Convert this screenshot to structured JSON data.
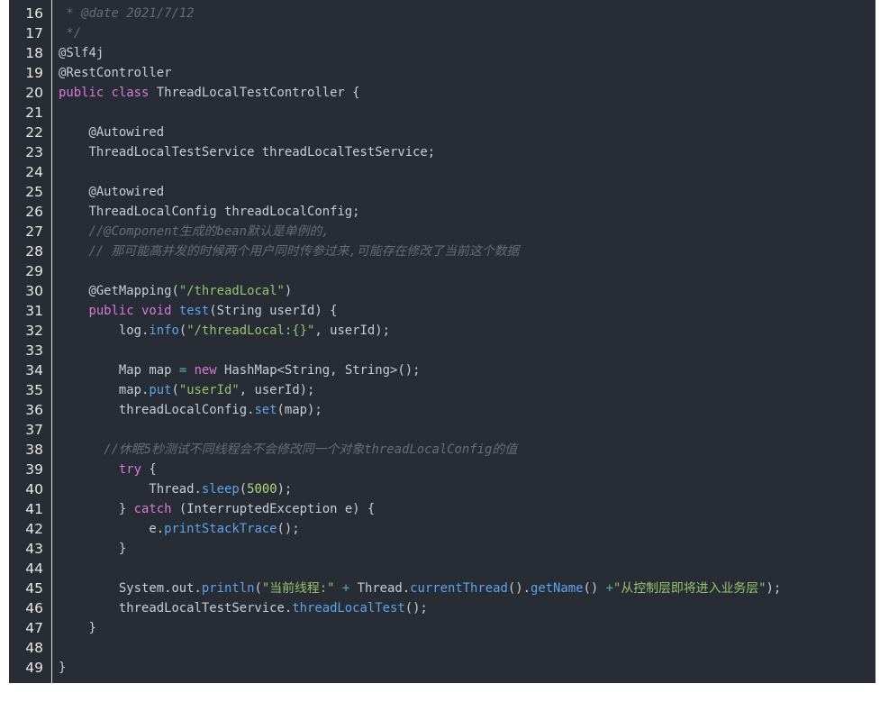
{
  "editor": {
    "lines": [
      {
        "n": "16",
        "tokens": [
          {
            "t": " * @date 2021/7/12",
            "c": "comment"
          }
        ]
      },
      {
        "n": "17",
        "tokens": [
          {
            "t": " */",
            "c": "comment"
          }
        ]
      },
      {
        "n": "18",
        "tokens": [
          {
            "t": "@Slf4j",
            "c": "plain"
          }
        ]
      },
      {
        "n": "19",
        "tokens": [
          {
            "t": "@RestController",
            "c": "plain"
          }
        ]
      },
      {
        "n": "20",
        "tokens": [
          {
            "t": "public class",
            "c": "keyword"
          },
          {
            "t": " ThreadLocalTestController {",
            "c": "plain"
          }
        ]
      },
      {
        "n": "21",
        "tokens": []
      },
      {
        "n": "22",
        "tokens": [
          {
            "t": "    @Autowired",
            "c": "plain"
          }
        ]
      },
      {
        "n": "23",
        "tokens": [
          {
            "t": "    ThreadLocalTestService threadLocalTestService;",
            "c": "plain"
          }
        ]
      },
      {
        "n": "24",
        "tokens": []
      },
      {
        "n": "25",
        "tokens": [
          {
            "t": "    @Autowired",
            "c": "plain"
          }
        ]
      },
      {
        "n": "26",
        "tokens": [
          {
            "t": "    ThreadLocalConfig threadLocalConfig;",
            "c": "plain"
          }
        ]
      },
      {
        "n": "27",
        "tokens": [
          {
            "t": "    //@Component生成的bean默认是单例的,",
            "c": "comment"
          }
        ]
      },
      {
        "n": "28",
        "tokens": [
          {
            "t": "    // 那可能高并发的时候两个用户同时传参过来,可能存在修改了当前这个数据",
            "c": "comment"
          }
        ]
      },
      {
        "n": "29",
        "tokens": []
      },
      {
        "n": "30",
        "tokens": [
          {
            "t": "    @GetMapping(",
            "c": "plain"
          },
          {
            "t": "\"/threadLocal\"",
            "c": "string"
          },
          {
            "t": ")",
            "c": "plain"
          }
        ]
      },
      {
        "n": "31",
        "tokens": [
          {
            "t": "    ",
            "c": "plain"
          },
          {
            "t": "public void",
            "c": "keyword"
          },
          {
            "t": " ",
            "c": "plain"
          },
          {
            "t": "test",
            "c": "func"
          },
          {
            "t": "(String userId) {",
            "c": "plain"
          }
        ]
      },
      {
        "n": "32",
        "tokens": [
          {
            "t": "        log.",
            "c": "plain"
          },
          {
            "t": "info",
            "c": "func"
          },
          {
            "t": "(",
            "c": "plain"
          },
          {
            "t": "\"/threadLocal:{}\"",
            "c": "string"
          },
          {
            "t": ", userId);",
            "c": "plain"
          }
        ]
      },
      {
        "n": "33",
        "tokens": []
      },
      {
        "n": "34",
        "tokens": [
          {
            "t": "        Map map ",
            "c": "plain"
          },
          {
            "t": "=",
            "c": "operator"
          },
          {
            "t": " ",
            "c": "plain"
          },
          {
            "t": "new",
            "c": "keyword"
          },
          {
            "t": " HashMap<String, String>();",
            "c": "plain"
          }
        ]
      },
      {
        "n": "35",
        "tokens": [
          {
            "t": "        map.",
            "c": "plain"
          },
          {
            "t": "put",
            "c": "func"
          },
          {
            "t": "(",
            "c": "plain"
          },
          {
            "t": "\"userId\"",
            "c": "string"
          },
          {
            "t": ", userId);",
            "c": "plain"
          }
        ]
      },
      {
        "n": "36",
        "tokens": [
          {
            "t": "        threadLocalConfig.",
            "c": "plain"
          },
          {
            "t": "set",
            "c": "func"
          },
          {
            "t": "(map);",
            "c": "plain"
          }
        ]
      },
      {
        "n": "37",
        "tokens": []
      },
      {
        "n": "38",
        "tokens": [
          {
            "t": "      //休眠5秒测试不同线程会不会修改同一个对象threadLocalConfig的值",
            "c": "comment"
          }
        ]
      },
      {
        "n": "39",
        "tokens": [
          {
            "t": "        ",
            "c": "plain"
          },
          {
            "t": "try",
            "c": "keyword"
          },
          {
            "t": " {",
            "c": "plain"
          }
        ]
      },
      {
        "n": "40",
        "tokens": [
          {
            "t": "            Thread.",
            "c": "plain"
          },
          {
            "t": "sleep",
            "c": "func"
          },
          {
            "t": "(",
            "c": "plain"
          },
          {
            "t": "5000",
            "c": "number"
          },
          {
            "t": ");",
            "c": "plain"
          }
        ]
      },
      {
        "n": "41",
        "tokens": [
          {
            "t": "        } ",
            "c": "plain"
          },
          {
            "t": "catch",
            "c": "keyword"
          },
          {
            "t": " (InterruptedException e) {",
            "c": "plain"
          }
        ]
      },
      {
        "n": "42",
        "tokens": [
          {
            "t": "            e.",
            "c": "plain"
          },
          {
            "t": "printStackTrace",
            "c": "func"
          },
          {
            "t": "();",
            "c": "plain"
          }
        ]
      },
      {
        "n": "43",
        "tokens": [
          {
            "t": "        }",
            "c": "plain"
          }
        ]
      },
      {
        "n": "44",
        "tokens": []
      },
      {
        "n": "45",
        "tokens": [
          {
            "t": "        System.out.",
            "c": "plain"
          },
          {
            "t": "println",
            "c": "func"
          },
          {
            "t": "(",
            "c": "plain"
          },
          {
            "t": "\"当前线程:\"",
            "c": "string"
          },
          {
            "t": " ",
            "c": "plain"
          },
          {
            "t": "+",
            "c": "operator"
          },
          {
            "t": " Thread.",
            "c": "plain"
          },
          {
            "t": "currentThread",
            "c": "func"
          },
          {
            "t": "().",
            "c": "plain"
          },
          {
            "t": "getName",
            "c": "func"
          },
          {
            "t": "() ",
            "c": "plain"
          },
          {
            "t": "+",
            "c": "operator"
          },
          {
            "t": "\"从控制层即将进入业务层\"",
            "c": "string"
          },
          {
            "t": ");",
            "c": "plain"
          }
        ]
      },
      {
        "n": "46",
        "tokens": [
          {
            "t": "        threadLocalTestService.",
            "c": "plain"
          },
          {
            "t": "threadLocalTest",
            "c": "func"
          },
          {
            "t": "();",
            "c": "plain"
          }
        ]
      },
      {
        "n": "47",
        "tokens": [
          {
            "t": "    }",
            "c": "plain"
          }
        ]
      },
      {
        "n": "48",
        "tokens": []
      },
      {
        "n": "49",
        "tokens": [
          {
            "t": "}",
            "c": "plain"
          }
        ]
      }
    ]
  }
}
